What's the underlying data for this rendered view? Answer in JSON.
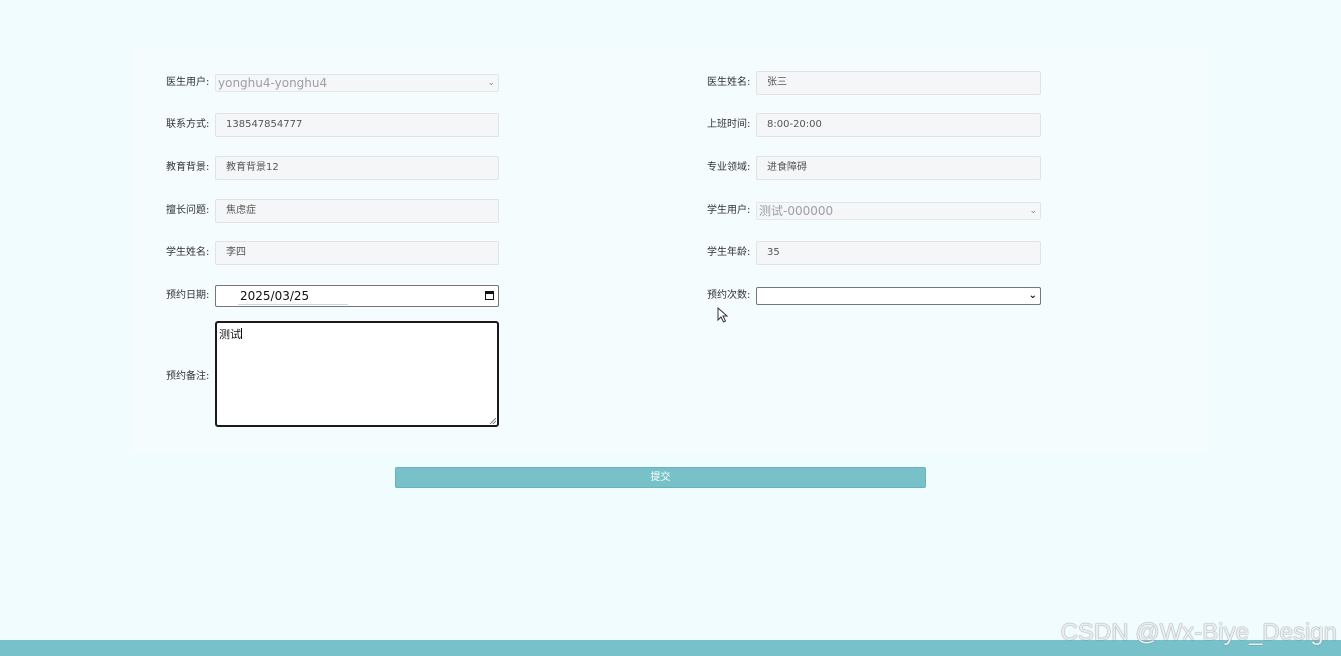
{
  "form": {
    "doctor_user": {
      "label": "医生用户:",
      "value": "yonghu4-yonghu4"
    },
    "doctor_name": {
      "label": "医生姓名:",
      "value": "张三"
    },
    "contact": {
      "label": "联系方式:",
      "value": "138547854777"
    },
    "work_time": {
      "label": "上班时间:",
      "value": "8:00-20:00"
    },
    "education": {
      "label": "教育背景:",
      "value": "教育背景12"
    },
    "specialty": {
      "label": "专业领域:",
      "value": "进食障碍"
    },
    "expertise": {
      "label": "擅长问题:",
      "value": "焦虑症"
    },
    "student_user": {
      "label": "学生用户:",
      "value": "测试-000000"
    },
    "student_name": {
      "label": "学生姓名:",
      "value": "李四"
    },
    "student_age": {
      "label": "学生年龄:",
      "value": "35"
    },
    "appointment_date": {
      "label": "预约日期:",
      "value": "2025/03/25"
    },
    "appointment_count": {
      "label": "预约次数:",
      "value": ""
    },
    "appointment_note": {
      "label": "预约备注:",
      "value": "测试"
    }
  },
  "submit_label": "提交",
  "watermark": "CSDN @Wx-Biye_Design",
  "colors": {
    "page_background": "#f1fcfe",
    "accent": "#77c2ca"
  }
}
